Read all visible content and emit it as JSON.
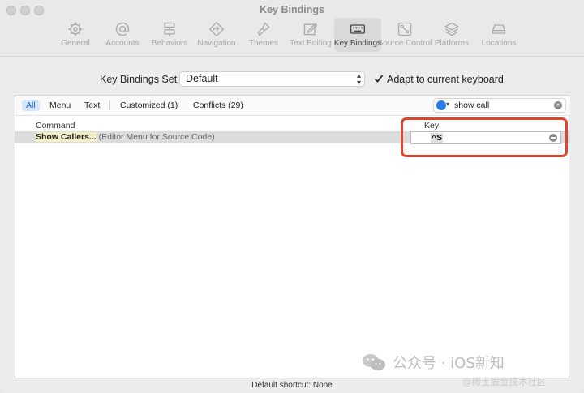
{
  "window": {
    "title": "Key Bindings"
  },
  "toolbar": {
    "items": [
      {
        "label": "General",
        "icon": "gear-icon"
      },
      {
        "label": "Accounts",
        "icon": "at-icon"
      },
      {
        "label": "Behaviors",
        "icon": "behaviors-icon"
      },
      {
        "label": "Navigation",
        "icon": "navigation-icon"
      },
      {
        "label": "Themes",
        "icon": "brush-icon"
      },
      {
        "label": "Text Editing",
        "icon": "pencil-icon"
      },
      {
        "label": "Key Bindings",
        "icon": "keyboard-icon",
        "active": true
      },
      {
        "label": "Source Control",
        "icon": "source-control-icon"
      },
      {
        "label": "Platforms",
        "icon": "layers-icon"
      },
      {
        "label": "Locations",
        "icon": "drive-icon"
      }
    ]
  },
  "key_bindings_set": {
    "label": "Key Bindings Set",
    "selected": "Default",
    "adapt_label": "Adapt to current keyboard",
    "adapt_checked": true
  },
  "filters": {
    "tabs": [
      "All",
      "Menu",
      "Text",
      "Customized (1)",
      "Conflicts (29)"
    ],
    "active": "All"
  },
  "search": {
    "value": "show call"
  },
  "table": {
    "headers": {
      "command": "Command",
      "key": "Key"
    },
    "rows": [
      {
        "command_bold": "Show Callers...",
        "command_context": " (Editor Menu for Source Code)",
        "key": "^S"
      }
    ]
  },
  "status": {
    "text": "Default shortcut: None"
  },
  "watermark": {
    "text": "公众号 · iOS新知",
    "sub": "@稀土掘金技术社区"
  },
  "colors": {
    "accent": "#2a7be4",
    "highlight_box": "#e0442d"
  }
}
